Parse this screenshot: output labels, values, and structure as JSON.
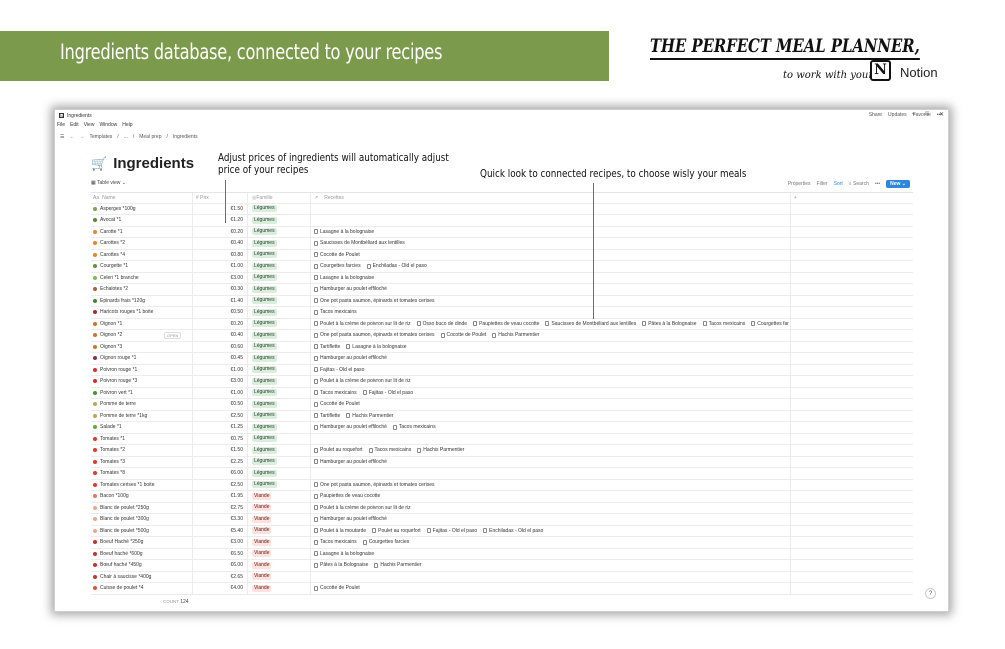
{
  "banner": {
    "title": "Ingredients database, connected to your recipes"
  },
  "logo": {
    "top": "THE PERFECT MEAL PLANNER,",
    "sub": "to work with your",
    "brand": "Notion"
  },
  "window": {
    "title": "Ingredients",
    "menu": [
      "File",
      "Edit",
      "View",
      "Window",
      "Help"
    ],
    "breadcrumb": [
      "Templates",
      "...",
      "Meal prep",
      "Ingredients"
    ],
    "toolbar_right": [
      "Share",
      "Updates",
      "Favorite"
    ]
  },
  "page": {
    "title": "Ingredients",
    "view": "Table view"
  },
  "view_controls": {
    "properties": "Properties",
    "filter": "Filter",
    "sort": "Sort",
    "search": "Search",
    "new": "New"
  },
  "annotations": {
    "left": [
      "Adjust prices of ingredients will automatically adjust",
      "price of your recipes"
    ],
    "right": "Quick look to connected recipes, to choose wisly your meals"
  },
  "columns": {
    "name": "Name",
    "prix": "Prix",
    "famille": "Famille",
    "recettes": "Recettes"
  },
  "colors": {
    "legumes_bg": "#dbeddb",
    "viande_bg": "#ffe2dd",
    "banner": "#7b9a4c",
    "accent": "#2e86de"
  },
  "open_label": "OPEN",
  "rows": [
    {
      "name": "Asperges *100g",
      "icon": "#7da84a",
      "prix": "€1.50",
      "famille": "Légumes",
      "recettes": []
    },
    {
      "name": "Avocat *1",
      "icon": "#4e8a3a",
      "prix": "€1.20",
      "famille": "Légumes",
      "recettes": []
    },
    {
      "name": "Carotte *1",
      "icon": "#e8862a",
      "prix": "€0.20",
      "famille": "Légumes",
      "recettes": [
        "Lasagne à la bolognaise"
      ]
    },
    {
      "name": "Carottes *2",
      "icon": "#e8862a",
      "prix": "€0.40",
      "famille": "Légumes",
      "recettes": [
        "Saucisses de Montbéliard aux lentilles"
      ]
    },
    {
      "name": "Carottes *4",
      "icon": "#e8862a",
      "prix": "€0.80",
      "famille": "Légumes",
      "recettes": [
        "Cocotte de Poulet"
      ]
    },
    {
      "name": "Courgette *1",
      "icon": "#5a9a3a",
      "prix": "€1.00",
      "famille": "Légumes",
      "recettes": [
        "Courgettes farcies",
        "Enchiladas - Old el paso"
      ]
    },
    {
      "name": "Celeri *1 branche",
      "icon": "#7cbf4a",
      "prix": "€3.00",
      "famille": "Légumes",
      "recettes": [
        "Lasagne à la bolognaise"
      ]
    },
    {
      "name": "Echalotes *2",
      "icon": "#b0603a",
      "prix": "€0.30",
      "famille": "Légumes",
      "recettes": [
        "Hamburger au poulet effiloché"
      ]
    },
    {
      "name": "Epinards frais *120g",
      "icon": "#3f8a2f",
      "prix": "€1.40",
      "famille": "Légumes",
      "recettes": [
        "One pot pasta saumon, épinards et tomates cerises"
      ]
    },
    {
      "name": "Haricots rouges *1 boite",
      "icon": "#a3322a",
      "prix": "€0.50",
      "famille": "Légumes",
      "recettes": [
        "Tacos mexicains"
      ]
    },
    {
      "name": "Oignon *1",
      "icon": "#c9772f",
      "prix": "€0.20",
      "famille": "Légumes",
      "recettes": [
        "Poulet à la crème de poivron sur lit de riz",
        "Osso buco de dinde",
        "Paupiettes de veau cocotte",
        "Saucisses de Montbéliard aux lentilles",
        "Pâtes à la Bolognaise",
        "Tacos mexicains",
        "Courgettes far"
      ]
    },
    {
      "name": "Oignon *2",
      "icon": "#c9772f",
      "prix": "€0.40",
      "famille": "Légumes",
      "recettes": [
        "One pot pasta saumon, épinards et tomates cerises",
        "Cocotte de Poulet",
        "Hachis Parmentier"
      ],
      "open": true
    },
    {
      "name": "Oignon *3",
      "icon": "#c9772f",
      "prix": "€0.60",
      "famille": "Légumes",
      "recettes": [
        "Tartiflette",
        "Lasagne à la bolognaise"
      ]
    },
    {
      "name": "Oignon rouge *1",
      "icon": "#8a2f5a",
      "prix": "€0.45",
      "famille": "Légumes",
      "recettes": [
        "Hamburger au poulet effiloché"
      ]
    },
    {
      "name": "Poivron rouge *1",
      "icon": "#d32f2f",
      "prix": "€1.00",
      "famille": "Légumes",
      "recettes": [
        "Fajitas - Old el paso"
      ]
    },
    {
      "name": "Poivron rouge *3",
      "icon": "#d32f2f",
      "prix": "€3.00",
      "famille": "Légumes",
      "recettes": [
        "Poulet à la crème de poivron sur lit de riz"
      ]
    },
    {
      "name": "Poivron vert *1",
      "icon": "#3f9a2f",
      "prix": "€1.00",
      "famille": "Légumes",
      "recettes": [
        "Tacos mexicains",
        "Fajitas - Old el paso"
      ]
    },
    {
      "name": "Pomme de terre",
      "icon": "#c8a060",
      "prix": "€0.50",
      "famille": "Légumes",
      "recettes": [
        "Cocotte de Poulet"
      ]
    },
    {
      "name": "Pomme de terre *1kg",
      "icon": "#c8a060",
      "prix": "€2.50",
      "famille": "Légumes",
      "recettes": [
        "Tartiflette",
        "Hachis Parmentier"
      ]
    },
    {
      "name": "Salade *1",
      "icon": "#5aaf3a",
      "prix": "€1.25",
      "famille": "Légumes",
      "recettes": [
        "Hamburger au poulet effiloché",
        "Tacos mexicains"
      ]
    },
    {
      "name": "Tomates *1",
      "icon": "#e03a2a",
      "prix": "€0.75",
      "famille": "Légumes",
      "recettes": []
    },
    {
      "name": "Tomates *2",
      "icon": "#e03a2a",
      "prix": "€1.50",
      "famille": "Légumes",
      "recettes": [
        "Poulet au roquefort",
        "Tacos mexicains",
        "Hachis Parmentier"
      ]
    },
    {
      "name": "Tomates *3",
      "icon": "#e03a2a",
      "prix": "€2.25",
      "famille": "Légumes",
      "recettes": [
        "Hamburger au poulet effiloché"
      ]
    },
    {
      "name": "Tomates *8",
      "icon": "#e03a2a",
      "prix": "€6.00",
      "famille": "Légumes",
      "recettes": []
    },
    {
      "name": "Tomates cerises *1 boite",
      "icon": "#e03a2a",
      "prix": "€2.50",
      "famille": "Légumes",
      "recettes": [
        "One pot pasta saumon, épinards et tomates cerises"
      ]
    },
    {
      "name": "Bacon *100g",
      "icon": "#e07a6a",
      "prix": "€1.95",
      "famille": "Viande",
      "recettes": [
        "Paupiettes de veau cocotte"
      ]
    },
    {
      "name": "Blanc de poulet *250g",
      "icon": "#f0a58a",
      "prix": "€2.75",
      "famille": "Viande",
      "recettes": [
        "Poulet à la crème de poivron sur lit de riz"
      ]
    },
    {
      "name": "Blanc de poulet *300g",
      "icon": "#f0a58a",
      "prix": "€3.30",
      "famille": "Viande",
      "recettes": [
        "Hamburger au poulet effiloché"
      ]
    },
    {
      "name": "Blanc de poulet *500g",
      "icon": "#f0a58a",
      "prix": "€5.40",
      "famille": "Viande",
      "recettes": [
        "Poulet à la moutarde",
        "Poulet au roquefort",
        "Fajitas - Old el paso",
        "Enchiladas - Old el paso"
      ]
    },
    {
      "name": "Boeuf Haché *250g",
      "icon": "#c0392b",
      "prix": "€3.00",
      "famille": "Viande",
      "recettes": [
        "Tacos mexicains",
        "Courgettes farcies"
      ]
    },
    {
      "name": "Boeuf haché *600g",
      "icon": "#c0392b",
      "prix": "€6.50",
      "famille": "Viande",
      "recettes": [
        "Lasagne à la bolognaise"
      ]
    },
    {
      "name": "Bœuf haché *450g",
      "icon": "#c0392b",
      "prix": "€6.00",
      "famille": "Viande",
      "recettes": [
        "Pâtes à la Bolognaise",
        "Hachis Parmentier"
      ]
    },
    {
      "name": "Chair à saucisse *400g",
      "icon": "#c0392b",
      "prix": "€2.65",
      "famille": "Viande",
      "recettes": []
    },
    {
      "name": "Cuisse de poulet *4",
      "icon": "#d05a3a",
      "prix": "€4.00",
      "famille": "Viande",
      "recettes": [
        "Cocotte de Poulet"
      ]
    }
  ],
  "footer": {
    "count_label": "COUNT",
    "count": "124"
  }
}
